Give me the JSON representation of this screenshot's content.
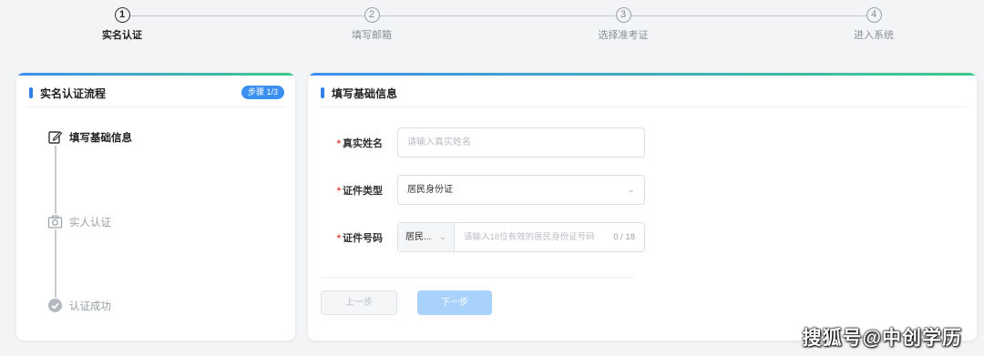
{
  "stepper": {
    "steps": [
      {
        "number": "1",
        "label": "实名认证",
        "active": true
      },
      {
        "number": "2",
        "label": "填写邮箱",
        "active": false
      },
      {
        "number": "3",
        "label": "选择准考证",
        "active": false
      },
      {
        "number": "4",
        "label": "进入系统",
        "active": false
      }
    ]
  },
  "left_card": {
    "title": "实名认证流程",
    "badge": "步骤 1/3",
    "timeline": [
      {
        "label": "填写基础信息",
        "icon": "edit-icon",
        "current": true
      },
      {
        "label": "实人认证",
        "icon": "camera-icon",
        "current": false
      },
      {
        "label": "认证成功",
        "icon": "check-circle-icon",
        "current": false
      }
    ]
  },
  "right_card": {
    "title": "填写基础信息",
    "fields": {
      "name": {
        "label": "真实姓名",
        "placeholder": "请输入真实姓名"
      },
      "id_type": {
        "label": "证件类型",
        "value": "居民身份证"
      },
      "id_number": {
        "label": "证件号码",
        "prefix": "居民...",
        "placeholder": "请输入18位有效的居民身份证号码",
        "counter": "0 / 18"
      }
    },
    "buttons": {
      "prev": "上一步",
      "next": "下一步"
    }
  },
  "watermark": "搜狐号@中创学历",
  "colors": {
    "accent": "#2f7fe8",
    "gradient_start": "#3b8ff0",
    "gradient_end": "#3fc98a",
    "required": "#e8453c",
    "next_button": "#a9d2fb"
  }
}
